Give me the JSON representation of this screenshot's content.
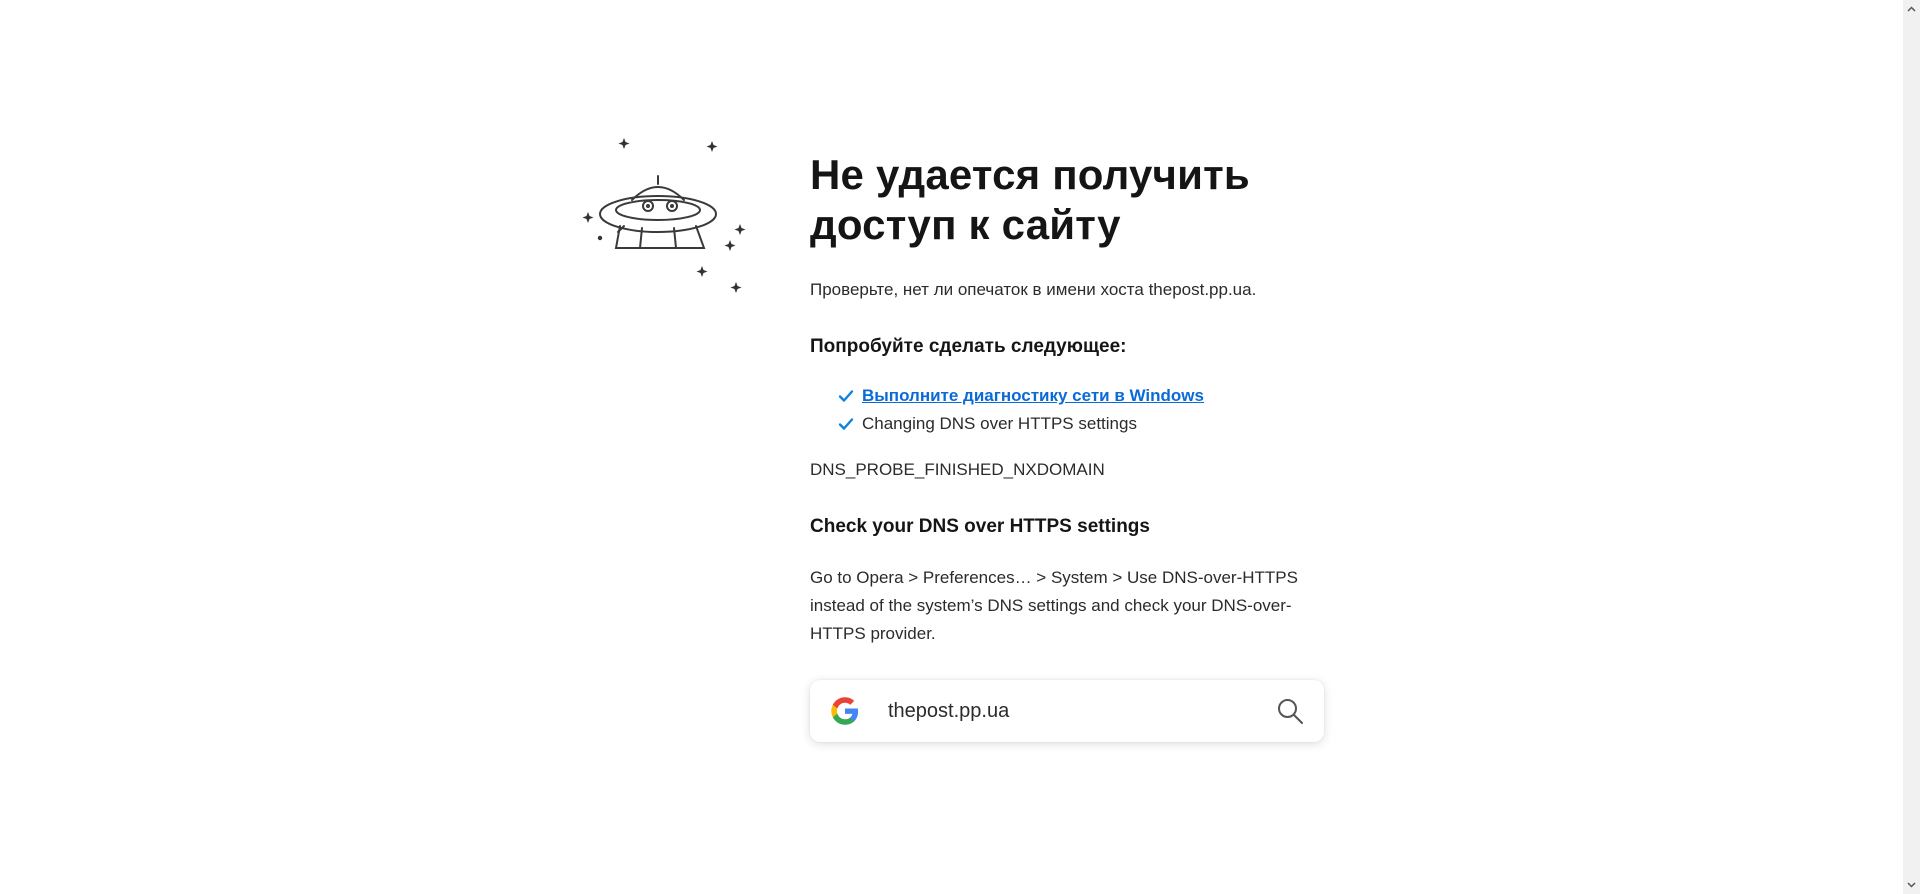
{
  "error": {
    "title": "Не удается получить доступ к сайту",
    "hint": "Проверьте, нет ли опечаток в имени хоста thepost.pp.ua.",
    "try_heading": "Попробуйте сделать следующее:",
    "suggestions": [
      {
        "label": "Выполните диагностику сети в Windows",
        "is_link": true
      },
      {
        "label": "Changing DNS over HTTPS settings",
        "is_link": false
      }
    ],
    "code": "DNS_PROBE_FINISHED_NXDOMAIN"
  },
  "dns_section": {
    "heading": "Check your DNS over HTTPS settings",
    "body": "Go to Opera > Preferences… > System > Use DNS-over-HTTPS instead of the system’s DNS settings and check your DNS-over-HTTPS provider."
  },
  "search": {
    "value": "thepost.pp.ua",
    "engine_icon": "google-icon",
    "button_icon": "magnifier-icon"
  },
  "colors": {
    "link": "#0a6ad7",
    "check": "#0a84e0",
    "text": "#1f1f1f"
  }
}
